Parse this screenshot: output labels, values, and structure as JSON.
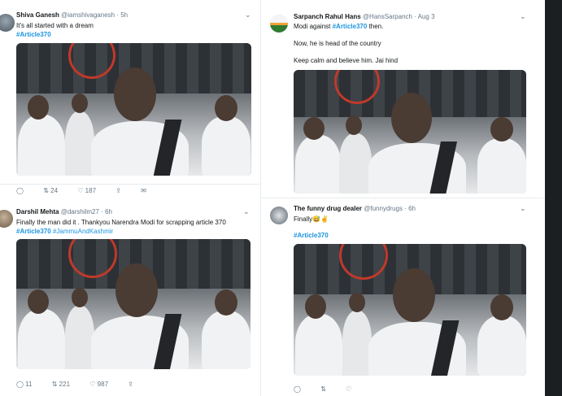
{
  "tweets": [
    {
      "name": "Shiva Ganesh",
      "handle": "@iamshivaganesh",
      "time": "· 5h",
      "lines": [
        "It's all started with a dream"
      ],
      "hashtags": "#Article370",
      "actions": {
        "reply": "",
        "retweet": "24",
        "like": "187"
      }
    },
    {
      "name": "Sarpanch Rahul Hans",
      "handle": "@HansSarpanch",
      "time": "· Aug 3",
      "lines": [
        "Modi against",
        "then.",
        "Now, he is head of the country",
        "Keep calm and believe him. Jai hind"
      ],
      "inline_tag": "#Article370"
    },
    {
      "name": "Darshil Mehta",
      "handle": "@darshilm27",
      "time": "· 6h",
      "lines": [
        "Finally the man did it . Thankyou Narendra Modi for scrapping article 370"
      ],
      "hashtags": "#Article370",
      "hashtags2": "#JammuAndKashmir",
      "actions": {
        "reply": "11",
        "retweet": "221",
        "like": "987"
      }
    },
    {
      "name": "The funny drug dealer",
      "handle": "@funnydrugs",
      "time": "· 6h",
      "lines": [
        "Finally😅✌️"
      ],
      "hashtags": "#Article370"
    }
  ],
  "icons": {
    "reply": "reply-icon",
    "retweet": "retweet-icon",
    "like": "like-icon",
    "share": "share-icon",
    "dm": "dm-icon",
    "chevron": "chevron-down-icon"
  },
  "colors": {
    "link": "#1b95e0",
    "background": "#ffffff",
    "strip": "#1c1f22"
  }
}
